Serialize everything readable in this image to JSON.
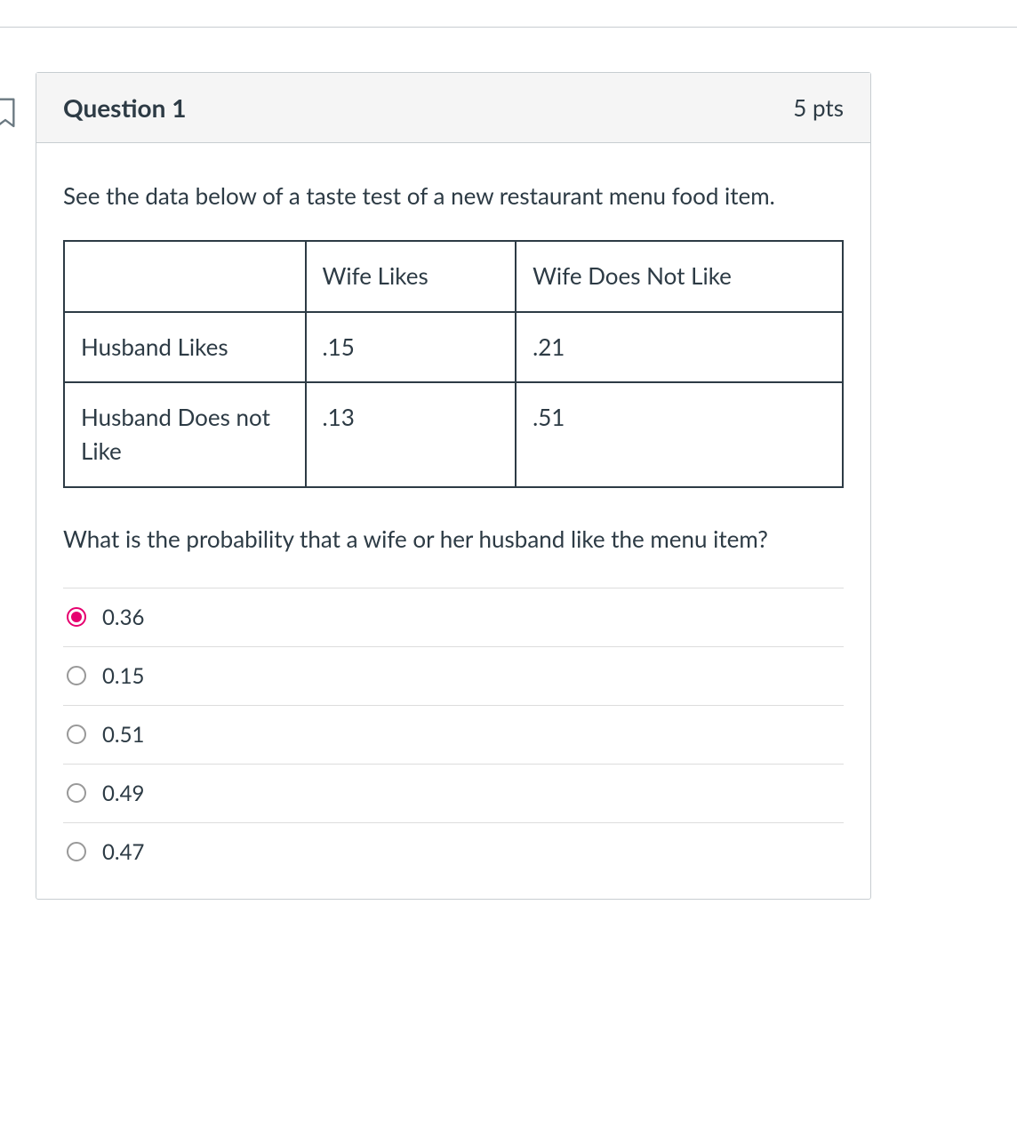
{
  "header": {
    "title": "Question 1",
    "points": "5 pts"
  },
  "prompt": "See the data below of a taste test of a new restaurant menu food item.",
  "table": {
    "headers": [
      "",
      "Wife Likes",
      "Wife Does Not Like"
    ],
    "rows": [
      [
        "Husband Likes",
        ".15",
        ".21"
      ],
      [
        "Husband Does not Like",
        ".13",
        ".51"
      ]
    ]
  },
  "question": "What is the probability that a wife or her husband like the menu item?",
  "options": [
    {
      "label": "0.36",
      "selected": true
    },
    {
      "label": "0.15",
      "selected": false
    },
    {
      "label": "0.51",
      "selected": false
    },
    {
      "label": "0.49",
      "selected": false
    },
    {
      "label": "0.47",
      "selected": false
    }
  ]
}
